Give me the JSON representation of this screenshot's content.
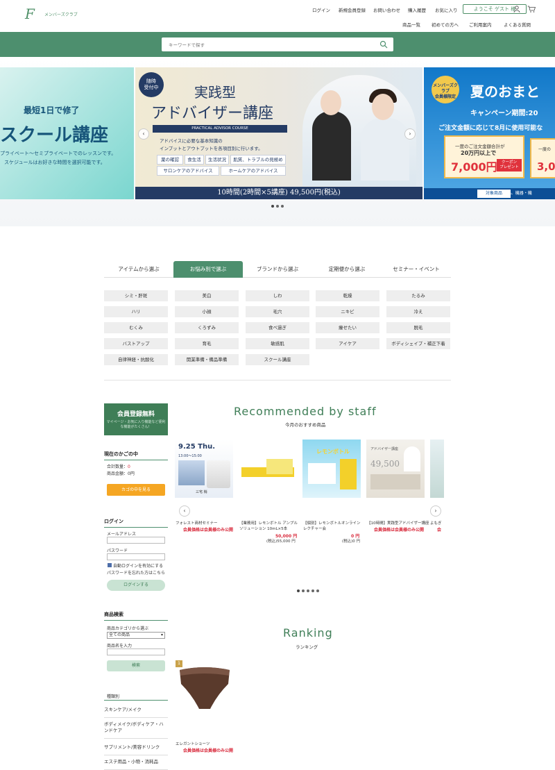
{
  "header": {
    "logo_mark": "F",
    "logo_text": "メンバーズクラブ",
    "top_links": [
      "ログイン",
      "新規会員登録",
      "お問い合わせ",
      "購入履歴",
      "お気に入り"
    ],
    "welcome": "ようこそ ゲスト 様",
    "nav": [
      "商品一覧",
      "初めての方へ",
      "ご利用案内",
      "よくある質問"
    ]
  },
  "search": {
    "placeholder": "キーワードで探す"
  },
  "banner": {
    "left": {
      "t1": "最短1日で修了",
      "t2": "スクール講座",
      "t3": "プライベート～セミプライベートでのレッスンです。",
      "t4": "スケジュールはお好きな時間を選択可能です。"
    },
    "mid": {
      "badge": "随時\n受付中",
      "title1": "実践型",
      "title2": "アドバイザー講座",
      "course": "PRACTICAL ADVISOR COURSE",
      "desc1": "アドバイスに必要な基本知識の",
      "desc2": "インプットとアウトプットを各項目別に行います。",
      "tags": [
        "薬の確認",
        "食生活",
        "生活状況",
        "肌質、トラブルの見極め",
        "サロンケアのアドバイス",
        "ホームケアのアドバイス"
      ],
      "price": "10時間(2時間×5講座) 49,500円(税込)"
    },
    "right": {
      "badge": "メンバーズクラブ\n会員様限定",
      "t1": "夏のおまと",
      "t2": "キャンペーン期間:20",
      "t3": "ご注文金額に応じて8月に使用可能な",
      "c1a": "一度のご注文金額合計が",
      "c1b": "20万円以上で",
      "c1c": "7,000円",
      "c1d": "クーポン\nプレゼント",
      "c2a": "一度の",
      "c2b": "3,0",
      "label": "対象商品",
      "bottom": "キャンペーン商品、機器・機"
    }
  },
  "tabs": [
    "アイテムから選ぶ",
    "お悩み別で選ぶ",
    "ブランドから選ぶ",
    "定期便から選ぶ",
    "セミナー・イベント"
  ],
  "chips": [
    "シミ・肝斑",
    "美白",
    "しわ",
    "乾燥",
    "たるみ",
    "ハリ",
    "小顔",
    "毛穴",
    "ニキビ",
    "冷え",
    "むくみ",
    "くろずみ",
    "食べ過ぎ",
    "痩せたい",
    "脱毛",
    "バストアップ",
    "育毛",
    "敏感肌",
    "アイケア",
    "ボディシェイプ・補正下着",
    "自律神経・抗酸化",
    "開業準備・備品準備",
    "スクール講座"
  ],
  "sidebar": {
    "reg_title": "会員登録無料",
    "reg_sub": "マイページ・お気に入り機能など便利な機能がたくさん！",
    "cart_h": "現在のかごの中",
    "cart_count_label": "合計数量：",
    "cart_count": "0",
    "cart_amount": "商品金額：0円",
    "cart_btn": "カゴの中を見る",
    "login_h": "ログイン",
    "email_label": "メールアドレス",
    "pw_label": "パスワード",
    "auto_login": "自動ログインを有効にする",
    "forgot": "パスワードを忘れた方はこちら",
    "login_btn": "ログインする",
    "search_h": "商品検索",
    "cat_label": "商品カテゴリから選ぶ",
    "cat_value": "全ての商品",
    "name_label": "商品名を入力",
    "search_btn": "検索",
    "type_h": "種類別",
    "types": [
      "スキンケア/メイク",
      "ボディメイク/ボディケア・ハンドケア",
      "サプリメント/美容ドリンク",
      "エステ用品・小物・消耗品"
    ]
  },
  "recommended": {
    "title": "Recommended by staff",
    "sub": "今月のおすすめ商品",
    "items": [
      {
        "name": "フォレスト商材セミナー",
        "price": "会員価格は会員様のみ公開",
        "tax": "",
        "thumb": "9.25 Thu.",
        "thumb_sub": "13:00～15:00",
        "thumb_person": "三宅 梢"
      },
      {
        "name": "【業務用】レモンボトル アンプル ソリューション 10mL×5本",
        "price": "50,000 円",
        "tax": "(税込)55,000 円"
      },
      {
        "name": "【個別】レモンボトルオンラインレクチャー会",
        "price": "0 円",
        "tax": "(税込)0 円",
        "thumb": "レモンボトル"
      },
      {
        "name": "【10時間】実践型アドバイザー講座",
        "price": "会員価格は会員様のみ公開",
        "tax": "",
        "thumb": "49,500",
        "thumb_sub": "アドバイザー講座"
      },
      {
        "name": "よもぎ",
        "price": "会",
        "tax": ""
      }
    ]
  },
  "ranking": {
    "title": "Ranking",
    "sub": "ランキング",
    "items": [
      {
        "rank": "1",
        "name": "エレガントショーツ",
        "price": "会員価格は会員様のみ公開"
      }
    ]
  }
}
